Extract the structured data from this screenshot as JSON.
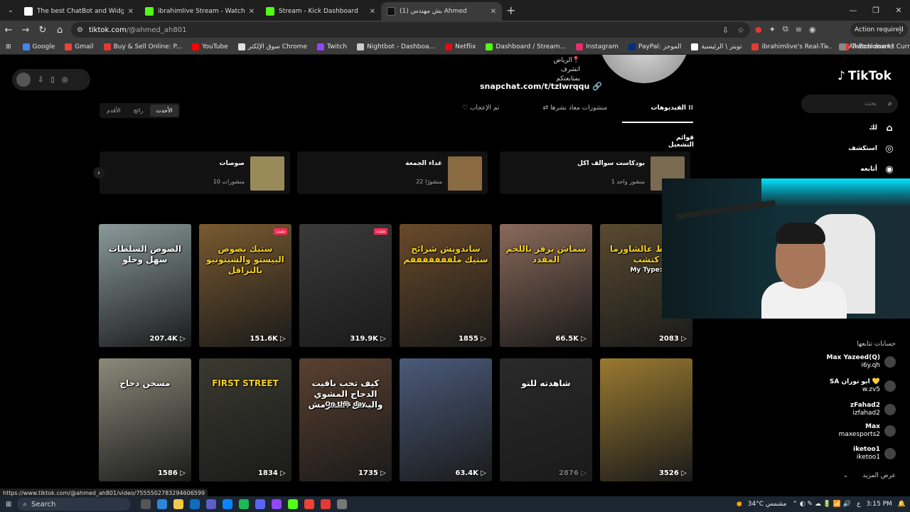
{
  "browser": {
    "tabs": [
      {
        "title": "The best ChatBot and Widgets f",
        "color": "#ffffff",
        "active": false
      },
      {
        "title": "ibrahimlive Stream - Watch Live",
        "color": "#53fc18",
        "active": false
      },
      {
        "title": "Stream - Kick Dashboard",
        "color": "#53fc18",
        "active": false
      },
      {
        "title": "(1) بش مهندس Ahmed",
        "color": "#111111",
        "active": true
      }
    ],
    "new_tab": "+",
    "url_host": "tiktok.com",
    "url_path": "/@ahmed_ah801",
    "action_required": "Action required",
    "bookmarks": [
      {
        "label": "Google",
        "color": "#4285f4"
      },
      {
        "label": "Gmail",
        "color": "#ea4335"
      },
      {
        "label": "Buy & Sell Online: P...",
        "color": "#e53935"
      },
      {
        "label": "YouTube",
        "color": "#ff0000"
      },
      {
        "label": "سوق الإلكتر Chrome",
        "color": "#e0e0e0"
      },
      {
        "label": "Twitch",
        "color": "#9146ff"
      },
      {
        "label": "Nightbot - Dashboa...",
        "color": "#cccccc"
      },
      {
        "label": "Netflix",
        "color": "#e50914"
      },
      {
        "label": "Dashboard / Stream...",
        "color": "#53fc18"
      },
      {
        "label": "Instagram",
        "color": "#e1306c"
      },
      {
        "label": "PayPal: الموجز",
        "color": "#003087"
      },
      {
        "label": "تويتر \\ الرئيسية",
        "color": "#ffffff"
      },
      {
        "label": "ibrahimlive's Real-Ti...",
        "color": "#e53935"
      },
      {
        "label": "Twitch down? Curre...",
        "color": "#e53935"
      }
    ],
    "all_bookmarks": "All Bookmarks",
    "status_url": "https://www.tiktok.com/@ahmed_ah801/video/7555502783294606599"
  },
  "profile": {
    "location_line1": "الرياض📍",
    "location_line2": "اتشرف بمتابعتكم",
    "snapchat": "snapchat.com/t/tzlwrqqu",
    "filters": [
      "الأحدث",
      "رائج",
      "الأقدم"
    ],
    "tabs": [
      "الفيديوهات",
      "منشورات معاد نشرها",
      "تم الإعجاب"
    ],
    "playlists_title": "قوائم التشغيل",
    "playlists": [
      {
        "name": "بودكاست سوالف اكل",
        "count": "منشور واحد 1",
        "color": "#7a6a50"
      },
      {
        "name": "غداء الجمعة",
        "count": "22 منشورًا",
        "color": "#8a6a40"
      },
      {
        "name": "صوصات",
        "count": "10 منشورات",
        "color": "#9a8a5a"
      }
    ]
  },
  "videos": [
    {
      "caption": "ماتحط عالشاورما كتشب",
      "sub": "My Type:",
      "views": "2083",
      "color": "#5a4a30",
      "pinned": false,
      "yellow": true
    },
    {
      "caption": "سماش برقر باللحم المقدد",
      "sub": "",
      "views": "66.5K",
      "color": "#8a6a5a",
      "pinned": false,
      "yellow": true
    },
    {
      "caption": "ساندويش شرائح ستيك ملفففففففم",
      "sub": "",
      "views": "1855",
      "color": "#6a4a2a",
      "pinned": false,
      "yellow": true
    },
    {
      "caption": "",
      "sub": "",
      "views": "319.9K",
      "color": "#3a3a3a",
      "pinned": true,
      "yellow": false
    },
    {
      "caption": "ستيك بصوص البيستو والشيتونيو بالنرافل",
      "sub": "",
      "views": "151.6K",
      "color": "#7a5a30",
      "pinned": true,
      "yellow": true
    },
    {
      "caption": "الصوص السلطات سهل وحلو",
      "sub": "",
      "views": "207.4K",
      "color": "#8a9a9a",
      "pinned": false,
      "yellow": false
    },
    {
      "caption": "",
      "sub": "",
      "views": "3526",
      "color": "#9a7a30",
      "pinned": false,
      "yellow": false
    },
    {
      "caption": "شاهدته للتو",
      "sub": "",
      "views": "2876",
      "color": "#2a2a2a",
      "pinned": false,
      "yellow": false,
      "dim": true
    },
    {
      "caption": "",
      "sub": "",
      "views": "63.4K",
      "color": "#4a5a7a",
      "pinned": false,
      "yellow": false
    },
    {
      "caption": "كيف تحب باقيت الدجاج المشوي والبصل المقرمش",
      "sub": "On this day",
      "views": "1735",
      "color": "#5a4030",
      "pinned": false,
      "yellow": false
    },
    {
      "caption": "FIRST STREET",
      "sub": "",
      "views": "1834",
      "color": "#3a3a30",
      "pinned": false,
      "yellow": true
    },
    {
      "caption": "مسخن دجاج",
      "sub": "",
      "views": "1586",
      "color": "#8a8a7a",
      "pinned": false,
      "yellow": false
    }
  ],
  "rail": {
    "logo": "TikTok",
    "search_placeholder": "بحث",
    "items": [
      "لك",
      "استكشف",
      "أتابعه"
    ],
    "following_title": "حسابات تتابعها",
    "following": [
      {
        "name": "Max Yazeed(Q)",
        "handle": "i6y.qh"
      },
      {
        "name": "SA ابو توران 💛",
        "handle": "w.zv5"
      },
      {
        "name": "zFahad2",
        "handle": "izfahad2"
      },
      {
        "name": "Max",
        "handle": "maxesports2"
      },
      {
        "name": "iketoo1",
        "handle": "iketoo1"
      }
    ],
    "show_more": "عرض المزيد"
  },
  "taskbar": {
    "search": "Search",
    "weather": "34°C مشمس",
    "lang": "ع",
    "time": "3:15 PM"
  }
}
